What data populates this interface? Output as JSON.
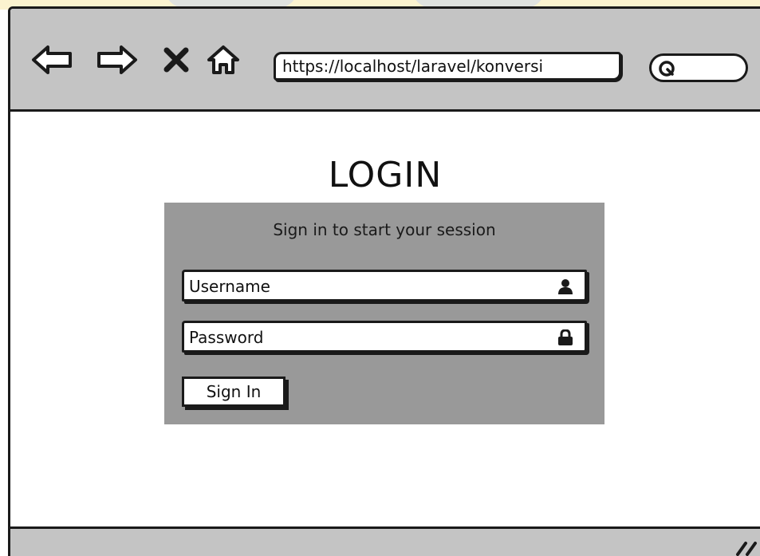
{
  "browser": {
    "url": "https://localhost/laravel/konversi",
    "nav_icons": [
      "back-arrow-icon",
      "forward-arrow-icon",
      "close-x-icon",
      "home-icon"
    ],
    "search_icon": "search-icon"
  },
  "page": {
    "title": "LOGIN",
    "subtitle": "Sign in to start your session",
    "username_placeholder": "Username",
    "username_icon": "user-icon",
    "password_placeholder": "Password",
    "password_icon": "lock-icon",
    "submit_label": "Sign In"
  },
  "colors": {
    "toolbar": "#c4c4c4",
    "panel": "#999999",
    "stroke": "#1a1a1a"
  }
}
